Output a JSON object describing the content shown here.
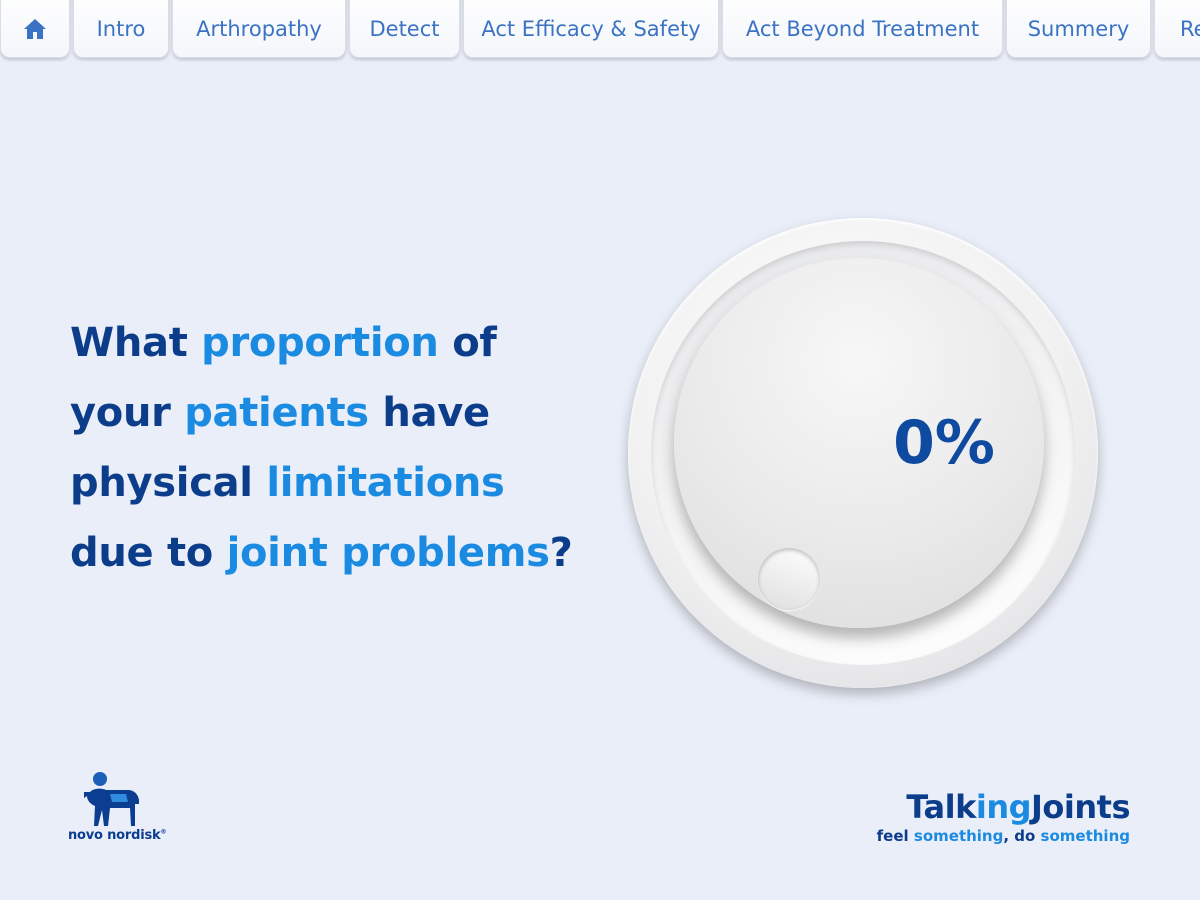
{
  "nav": {
    "tabs": [
      {
        "label": "Intro"
      },
      {
        "label": "Arthropathy"
      },
      {
        "label": "Detect"
      },
      {
        "label": "Act Efficacy & Safety"
      },
      {
        "label": "Act Beyond Treatment"
      },
      {
        "label": "Summery"
      },
      {
        "label": "Re"
      }
    ],
    "home_icon": "home-icon"
  },
  "question": {
    "line1": {
      "a": "What ",
      "b": "proportion",
      "c": " of"
    },
    "line2": {
      "a": "your ",
      "b": "patients",
      "c": " have"
    },
    "line3": {
      "a": "physical ",
      "b": "limitations"
    },
    "line4": {
      "a": "due to ",
      "b": "joint problems",
      "c": "?"
    }
  },
  "dial": {
    "value_text": "0%",
    "value": 0
  },
  "logos": {
    "left_text": "novo nordisk",
    "left_mark": "®",
    "right_title_a": "Talk",
    "right_title_b": "ing",
    "right_title_c": "Joints",
    "right_tag_a": "feel ",
    "right_tag_b": "something",
    "right_tag_c": ", do ",
    "right_tag_d": "something"
  },
  "colors": {
    "dark_blue": "#0c3d8a",
    "light_blue": "#1b8be2",
    "background": "#eaeef8"
  }
}
